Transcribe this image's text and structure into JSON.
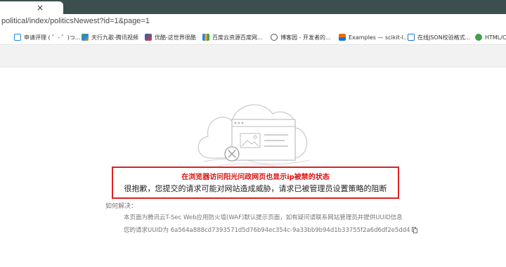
{
  "browser": {
    "new_tab_glyph": "+",
    "tab_close_glyph": "×",
    "url": "political/index/politicsNewest?id=1&page=1",
    "bookmarks": [
      {
        "label": "申请评理 ( ゜- ゜)つ...",
        "icon": "tv-icon",
        "color": "#1e88e5"
      },
      {
        "label": "天行九歌-腾讯视频",
        "icon": "play-icon",
        "color": "#2e7d32"
      },
      {
        "label": "优酷-这世界很酷",
        "icon": "youku-icon",
        "color": "#1565c0"
      },
      {
        "label": "百度云资源百度网...",
        "icon": "baidu-icon",
        "color": "#f9a825"
      },
      {
        "label": "博客园 - 开发者的...",
        "icon": "cnblogs-icon",
        "color": "#555555"
      },
      {
        "label": "Examples — scikit-l...",
        "icon": "chart-icon",
        "color": "#ef6c00"
      },
      {
        "label": "在线JSON校验格式...",
        "icon": "json-icon",
        "color": "#1976d2"
      },
      {
        "label": "HTML/C",
        "icon": "html-icon",
        "color": "#43a047"
      }
    ]
  },
  "page": {
    "annotation": "在浏览器访问阳光问政网页也显示ip被禁的状态",
    "block_message": "很抱歉，您提交的请求可能对网站造成威胁，请求已被管理员设置策略的阻断",
    "howto_label": "如何解决：",
    "description": "本页面为腾讯云T-Sec Web应用防火墙(WAF)默认提示页面，如有疑问请联系网站管理员并提供UUID信息",
    "uuid_line": "您的请求UUID为 6a564a888cd7393571d5d76b94ec354c-9a33bb9b94d1b33755f2a6d6df2e5dd4"
  }
}
